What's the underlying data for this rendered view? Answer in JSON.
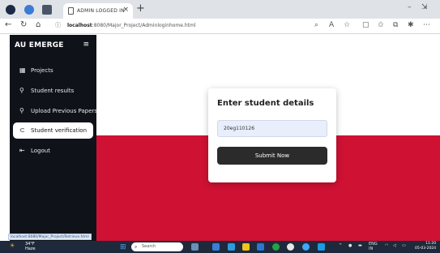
{
  "browser": {
    "tab_title": "ADMIN LOGGED IN",
    "tab_close": "×",
    "new_tab": "+",
    "url_host": "localhost",
    "url_path": ":8080/Major_Project/Adminloginhome.html",
    "minimize": "–",
    "restore": "⇲",
    "icons": [
      "back-icon",
      "refresh-icon",
      "home-icon",
      "info-icon",
      "zoom-icon",
      "read-aloud-icon",
      "favorite-icon",
      "split-screen-icon",
      "favorites-icon",
      "collections-icon",
      "extensions-icon",
      "more-icon"
    ]
  },
  "sidebar": {
    "brand": "AU EMERGE",
    "menu_icon": "≡",
    "items": [
      {
        "label": "Projects",
        "icon": "▦",
        "icon_name": "grid-icon"
      },
      {
        "label": "Student results",
        "icon": "⚲",
        "icon_name": "person-icon"
      },
      {
        "label": "Upload Previous Papers",
        "icon": "⚲",
        "icon_name": "person-icon"
      },
      {
        "label": "Student verification",
        "icon": "⊂",
        "icon_name": "link-icon"
      },
      {
        "label": "Logout",
        "icon": "⇤",
        "icon_name": "logout-icon"
      }
    ],
    "active_index": 3
  },
  "card": {
    "title": "Enter student details",
    "input_value": "20eg110126",
    "submit_label": "Submit Now"
  },
  "status_bar": {
    "url": "localhost:8080/Major_Project/Retrieve.html"
  },
  "taskbar": {
    "weather_temp": "34°F",
    "weather_desc": "Haze",
    "search_placeholder": "Search",
    "lang_top": "ENG",
    "lang_bottom": "IN",
    "time": "11:20",
    "date": "05-03-2024"
  },
  "colors": {
    "sidebar_bg": "#0f1319",
    "band_red": "#cf1133",
    "button_dark": "#2b2b2b",
    "input_bg": "#e8eefb"
  }
}
